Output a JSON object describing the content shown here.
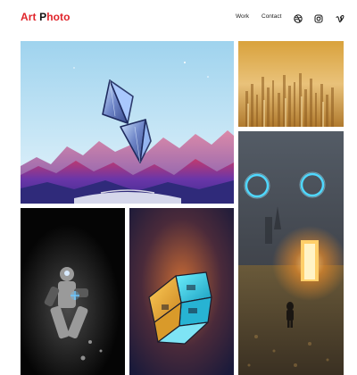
{
  "header": {
    "logo": {
      "part1": "Art",
      "part2": " P",
      "part3": "hoto"
    },
    "nav": {
      "work": "Work",
      "contact": "Contact"
    },
    "social": [
      "dribbble-icon",
      "instagram-icon",
      "vimeo-icon"
    ]
  },
  "colors": {
    "brand_red": "#e0242a",
    "text": "#111111",
    "background": "#ffffff"
  },
  "gallery": {
    "items": [
      {
        "subject": "crystal-pyramids-over-purple-mountains"
      },
      {
        "subject": "golden-pillars-city"
      },
      {
        "subject": "glowing-circle-eyes-portal"
      },
      {
        "subject": "astronaut-in-dark"
      },
      {
        "subject": "cyan-gold-cube"
      }
    ]
  }
}
